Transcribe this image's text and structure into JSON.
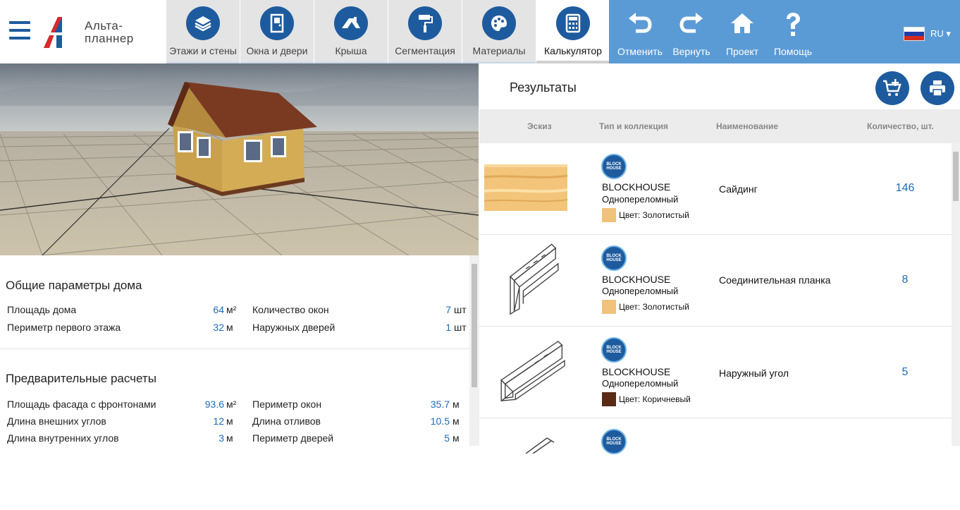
{
  "app": {
    "logo_line1": "Альта-",
    "logo_line2": "планнер"
  },
  "tabs": [
    {
      "label": "Этажи и стены",
      "icon": "layers-icon"
    },
    {
      "label": "Окна и двери",
      "icon": "door-icon"
    },
    {
      "label": "Крыша",
      "icon": "roof-icon"
    },
    {
      "label": "Сегментация",
      "icon": "paint-roller-icon"
    },
    {
      "label": "Материалы",
      "icon": "palette-icon"
    },
    {
      "label": "Калькулятор",
      "icon": "calculator-icon",
      "active": true
    }
  ],
  "actions": [
    {
      "label": "Отменить",
      "icon": "undo-icon"
    },
    {
      "label": "Вернуть",
      "icon": "redo-icon"
    },
    {
      "label": "Проект",
      "icon": "home-icon"
    },
    {
      "label": "Помощь",
      "icon": "help-icon"
    }
  ],
  "language": {
    "code": "RU ▾"
  },
  "general": {
    "title": "Общие параметры дома",
    "rows": [
      {
        "label": "Площадь дома",
        "value": "64",
        "unit": "м²"
      },
      {
        "label": "Периметр первого этажа",
        "value": "32",
        "unit": "м"
      },
      {
        "label": "Количество окон",
        "value": "7",
        "unit": "шт"
      },
      {
        "label": "Наружных дверей",
        "value": "1",
        "unit": "шт"
      }
    ]
  },
  "prelim": {
    "title": "Предварительные расчеты",
    "rows": [
      {
        "label": "Площадь фасада с фронтонами",
        "value": "93.6",
        "unit": "м²"
      },
      {
        "label": "Длина внешних углов",
        "value": "12",
        "unit": "м"
      },
      {
        "label": "Длина внутренних углов",
        "value": "3",
        "unit": "м"
      },
      {
        "label": "Периметр окон",
        "value": "35.7",
        "unit": "м"
      },
      {
        "label": "Длина отливов",
        "value": "10.5",
        "unit": "м"
      },
      {
        "label": "Периметр дверей",
        "value": "5",
        "unit": "м"
      }
    ]
  },
  "results": {
    "title": "Результаты",
    "columns": [
      "Эскиз",
      "Тип и коллекция",
      "Наименование",
      "Количество, шт."
    ],
    "badge_line1": "BLOCK",
    "badge_line2": "HOUSE",
    "items": [
      {
        "brand": "BLOCKHOUSE",
        "collection": "Одноперeломный",
        "color_label": "Цвет: Золотистый",
        "swatch": "#f0c27a",
        "name": "Сайдинг",
        "qty": "146"
      },
      {
        "brand": "BLOCKHOUSE",
        "collection": "Одноперeломный",
        "color_label": "Цвет: Золотистый",
        "swatch": "#f0c27a",
        "name": "Соединительная планка",
        "qty": "8"
      },
      {
        "brand": "BLOCKHOUSE",
        "collection": "Одноперeломный",
        "color_label": "Цвет: Коричневый",
        "swatch": "#5a2a14",
        "name": "Наружный угол",
        "qty": "5"
      }
    ]
  },
  "colors": {
    "accent": "#1e5b9e",
    "action_bar": "#5b9bd5",
    "value": "#1e6bb8"
  }
}
